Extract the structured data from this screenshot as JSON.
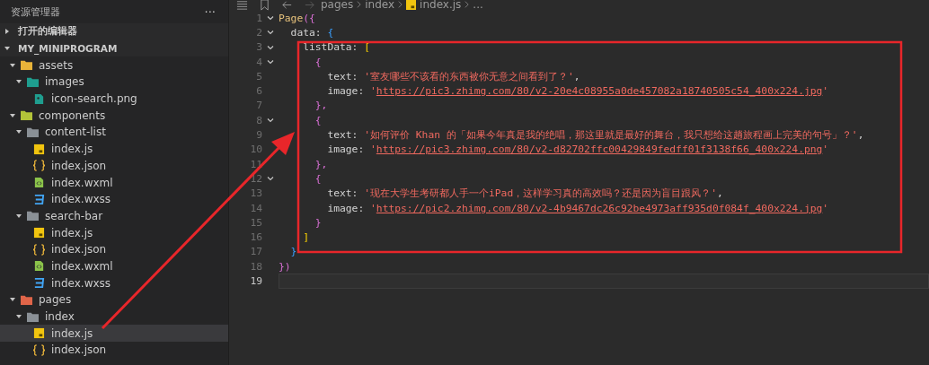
{
  "explorer": {
    "title": "资源管理器",
    "more": "···",
    "sections": [
      {
        "label": "打开的编辑器",
        "expanded": false
      },
      {
        "label": "MY_MINIPROGRAM",
        "expanded": true,
        "tree": [
          {
            "label": "assets",
            "kind": "folder-assets",
            "expanded": true,
            "selected": false,
            "children": [
              {
                "label": "images",
                "kind": "folder-images",
                "expanded": true,
                "selected": false,
                "children": [
                  {
                    "label": "icon-search.png",
                    "kind": "png",
                    "selected": false
                  }
                ]
              }
            ]
          },
          {
            "label": "components",
            "kind": "folder-components",
            "expanded": true,
            "selected": false,
            "children": [
              {
                "label": "content-list",
                "kind": "folder",
                "expanded": true,
                "selected": false,
                "children": [
                  {
                    "label": "index.js",
                    "kind": "js",
                    "selected": false
                  },
                  {
                    "label": "index.json",
                    "kind": "json",
                    "selected": false
                  },
                  {
                    "label": "index.wxml",
                    "kind": "wxml",
                    "selected": false
                  },
                  {
                    "label": "index.wxss",
                    "kind": "wxss",
                    "selected": false
                  }
                ]
              },
              {
                "label": "search-bar",
                "kind": "folder",
                "expanded": true,
                "selected": false,
                "children": [
                  {
                    "label": "index.js",
                    "kind": "js",
                    "selected": false
                  },
                  {
                    "label": "index.json",
                    "kind": "json",
                    "selected": false
                  },
                  {
                    "label": "index.wxml",
                    "kind": "wxml",
                    "selected": false
                  },
                  {
                    "label": "index.wxss",
                    "kind": "wxss",
                    "selected": false
                  }
                ]
              }
            ]
          },
          {
            "label": "pages",
            "kind": "folder-pages",
            "expanded": true,
            "selected": false,
            "children": [
              {
                "label": "index",
                "kind": "folder",
                "expanded": true,
                "selected": false,
                "children": [
                  {
                    "label": "index.js",
                    "kind": "js",
                    "selected": true
                  },
                  {
                    "label": "index.json",
                    "kind": "json",
                    "selected": false
                  }
                ]
              }
            ]
          }
        ]
      }
    ]
  },
  "editor": {
    "breadcrumb": [
      {
        "label": "pages"
      },
      {
        "label": "index"
      },
      {
        "label": "index.js",
        "kind": "js"
      },
      {
        "label": "..."
      }
    ],
    "lines": [
      {
        "number": "1",
        "foldable": true,
        "tokens": [
          {
            "text": "Page",
            "kind": "fn"
          },
          {
            "text": "({",
            "kind": "bracket-a"
          }
        ]
      },
      {
        "number": "2",
        "foldable": true,
        "tokens": [
          {
            "text": "  data: ",
            "kind": "key"
          },
          {
            "text": "{",
            "kind": "bracket-b"
          }
        ]
      },
      {
        "number": "3",
        "foldable": true,
        "tokens": [
          {
            "text": "    listData: ",
            "kind": "key"
          },
          {
            "text": "[",
            "kind": "bracket-c"
          }
        ]
      },
      {
        "number": "4",
        "foldable": true,
        "tokens": [
          {
            "text": "      {",
            "kind": "bracket-a"
          }
        ]
      },
      {
        "number": "5",
        "tokens": [
          {
            "text": "        text: ",
            "kind": "key"
          },
          {
            "text": "'室友哪些不该看的东西被你无意之间看到了？'",
            "kind": "string"
          },
          {
            "text": ",",
            "kind": "key"
          }
        ]
      },
      {
        "number": "6",
        "tokens": [
          {
            "text": "        image: ",
            "kind": "key"
          },
          {
            "text": "'",
            "kind": "string"
          },
          {
            "text": "https://pic3.zhimg.com/80/v2-20e4c08955a0de457082a18740505c54_400x224.jpg",
            "kind": "url"
          },
          {
            "text": "'",
            "kind": "string"
          }
        ]
      },
      {
        "number": "7",
        "tokens": [
          {
            "text": "      },",
            "kind": "bracket-a"
          }
        ]
      },
      {
        "number": "8",
        "foldable": true,
        "tokens": [
          {
            "text": "      {",
            "kind": "bracket-a"
          }
        ]
      },
      {
        "number": "9",
        "tokens": [
          {
            "text": "        text: ",
            "kind": "key"
          },
          {
            "text": "'如何评价 Khan 的「如果今年真是我的绝唱，那这里就是最好的舞台，我只想给这趟旅程画上完美的句号」？'",
            "kind": "string"
          },
          {
            "text": ",",
            "kind": "key"
          }
        ]
      },
      {
        "number": "10",
        "tokens": [
          {
            "text": "        image: ",
            "kind": "key"
          },
          {
            "text": "'",
            "kind": "string"
          },
          {
            "text": "https://pic3.zhimg.com/80/v2-d82702ffc00429849fedff01f3138f66_400x224.png",
            "kind": "url"
          },
          {
            "text": "'",
            "kind": "string"
          }
        ]
      },
      {
        "number": "11",
        "tokens": [
          {
            "text": "      },",
            "kind": "bracket-a"
          }
        ]
      },
      {
        "number": "12",
        "foldable": true,
        "tokens": [
          {
            "text": "      {",
            "kind": "bracket-a"
          }
        ]
      },
      {
        "number": "13",
        "tokens": [
          {
            "text": "        text: ",
            "kind": "key"
          },
          {
            "text": "'现在大学生考研都人手一个iPad，这样学习真的高效吗？还是因为盲目跟风？'",
            "kind": "string"
          },
          {
            "text": ",",
            "kind": "key"
          }
        ]
      },
      {
        "number": "14",
        "tokens": [
          {
            "text": "        image: ",
            "kind": "key"
          },
          {
            "text": "'",
            "kind": "string"
          },
          {
            "text": "https://pic2.zhimg.com/80/v2-4b9467dc26c92be4973aff935d0f084f_400x224.jpg",
            "kind": "url"
          },
          {
            "text": "'",
            "kind": "string"
          }
        ]
      },
      {
        "number": "15",
        "tokens": [
          {
            "text": "      }",
            "kind": "bracket-a"
          }
        ]
      },
      {
        "number": "16",
        "tokens": [
          {
            "text": "    ]",
            "kind": "bracket-c"
          }
        ]
      },
      {
        "number": "17",
        "tokens": [
          {
            "text": "  }",
            "kind": "bracket-b"
          }
        ]
      },
      {
        "number": "18",
        "tokens": [
          {
            "text": "})",
            "kind": "bracket-a"
          }
        ]
      },
      {
        "number": "19",
        "current": true
      }
    ]
  }
}
